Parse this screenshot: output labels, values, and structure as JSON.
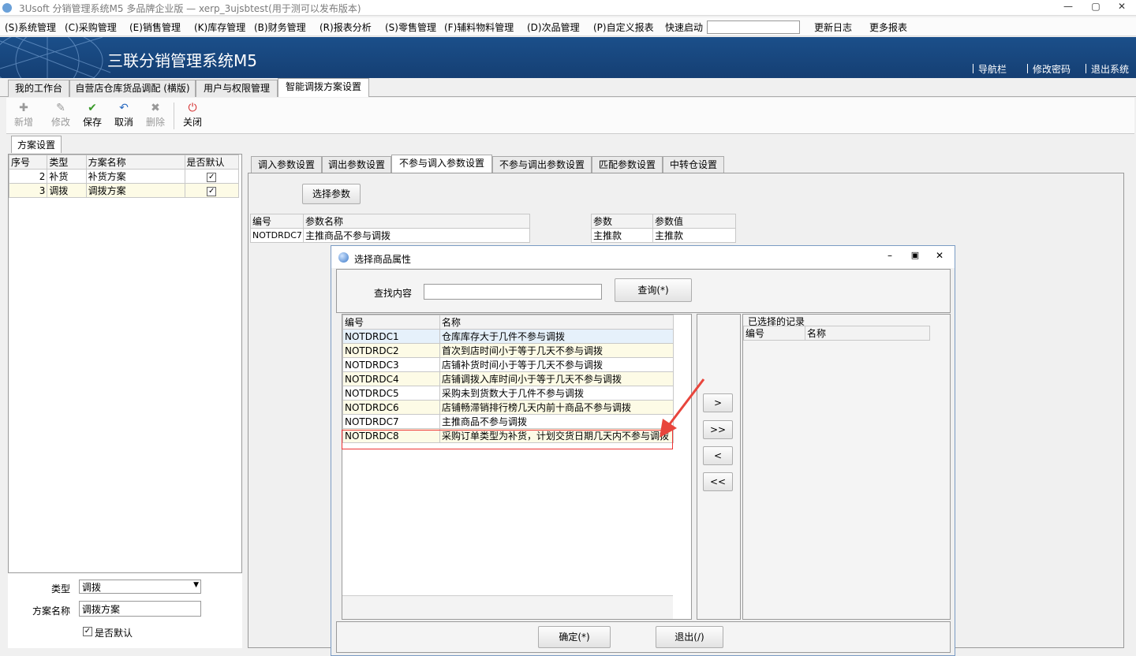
{
  "window": {
    "title": "3Usoft 分销管理系统M5 多品牌企业版 — xerp_3ujsbtest(用于测可以发布版本)",
    "min": "—",
    "max": "▢",
    "close": "✕"
  },
  "menu": {
    "items": [
      "(S)系统管理",
      "(C)采购管理",
      "(E)销售管理",
      "(K)库存管理",
      "(B)财务管理",
      "(R)报表分析",
      "(S)零售管理",
      "(F)辅料物料管理",
      "(D)次品管理",
      "(P)自定义报表"
    ],
    "quick_start": "快速启动",
    "changelog": "更新日志",
    "more_reports": "更多报表"
  },
  "banner": {
    "title": "三联分销管理系统M5",
    "nav": "导航栏",
    "change_pwd": "修改密码",
    "logout": "退出系统"
  },
  "main_tabs": [
    "我的工作台",
    "自营店仓库货品调配 (横版)",
    "用户与权限管理",
    "智能调拨方案设置"
  ],
  "toolbar": {
    "new": "新增",
    "edit": "修改",
    "save": "保存",
    "cancel": "取消",
    "delete": "删除",
    "close": "关闭"
  },
  "sub_tab": "方案设置",
  "scheme_grid": {
    "headers": [
      "序号",
      "类型",
      "方案名称",
      "是否默认"
    ],
    "rows": [
      {
        "no": "2",
        "type": "补货",
        "name": "补货方案",
        "checked": "✓"
      },
      {
        "no": "3",
        "type": "调拨",
        "name": "调拨方案",
        "checked": "✓"
      }
    ]
  },
  "form": {
    "type_label": "类型",
    "type_value": "调拨",
    "name_label": "方案名称",
    "name_value": "调拨方案",
    "default_label": "是否默认",
    "default_checked": "✓"
  },
  "param_tabs": [
    "调入参数设置",
    "调出参数设置",
    "不参与调入参数设置",
    "不参与调出参数设置",
    "匹配参数设置",
    "中转仓设置"
  ],
  "select_param_button": "选择参数",
  "param_grid": {
    "headers": [
      "编号",
      "参数名称"
    ],
    "rows": [
      {
        "code": "NOTDRDC7",
        "name": "主推商品不参与调拨"
      }
    ]
  },
  "value_grid": {
    "headers": [
      "参数",
      "参数值"
    ],
    "rows": [
      {
        "param": "主推款",
        "value": "主推款"
      }
    ]
  },
  "dialog": {
    "title": "选择商品属性",
    "search_label": "查找内容",
    "search_value": "",
    "query_button": "查询(*)",
    "list_headers": [
      "编号",
      "名称"
    ],
    "rows": [
      {
        "code": "NOTDRDC1",
        "name": "仓库库存大于几件不参与调拨"
      },
      {
        "code": "NOTDRDC2",
        "name": "首次到店时间小于等于几天不参与调拨"
      },
      {
        "code": "NOTDRDC3",
        "name": "店铺补货时间小于等于几天不参与调拨"
      },
      {
        "code": "NOTDRDC4",
        "name": "店铺调拨入库时间小于等于几天不参与调拨"
      },
      {
        "code": "NOTDRDC5",
        "name": "采购未到货数大于几件不参与调拨"
      },
      {
        "code": "NOTDRDC6",
        "name": "店铺畅滞销排行榜几天内前十商品不参与调拨"
      },
      {
        "code": "NOTDRDC7",
        "name": "主推商品不参与调拨"
      },
      {
        "code": "NOTDRDC8",
        "name": "采购订单类型为补货，计划交货日期几天内不参与调拨"
      }
    ],
    "move_right": ">",
    "move_all_right": ">>",
    "move_left": "<",
    "move_all_left": "<<",
    "selected_title": "已选择的记录",
    "selected_headers": [
      "编号",
      "名称"
    ],
    "ok_button": "确定(*)",
    "exit_button": "退出(/)"
  },
  "colors": {
    "banner": "#1b4f8a",
    "highlight": "#e33333",
    "accent_arrow": "#e8453c"
  }
}
